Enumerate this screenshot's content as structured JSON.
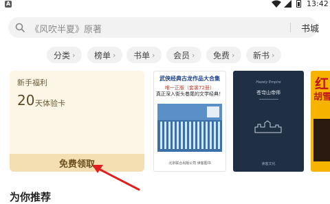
{
  "status_bar": {
    "app_badge": "A",
    "time": "13:42"
  },
  "search": {
    "placeholder": "《风吹半夏》原著",
    "library_label": "书城"
  },
  "categories": [
    {
      "label": "分类"
    },
    {
      "label": "榜单"
    },
    {
      "label": "书单"
    },
    {
      "label": "会员"
    },
    {
      "label": "免费"
    },
    {
      "label": "新书"
    }
  ],
  "welfare": {
    "title": "新手福利",
    "days": "20",
    "unit": "天体验卡",
    "claim_label": "免费领取"
  },
  "books": [
    {
      "title": "武侠经典古龙作品大合集",
      "subtitle": "唯一正版（套装72册）",
      "tagline": "真正深入街头巷尾的文学经典！",
      "badge": "北京联合出版公司  读客图书"
    },
    {
      "top": "Hazely Empire",
      "title": "苍穹山帝师",
      "bottom": "读客文化"
    },
    {
      "title": "红",
      "subtitle": "胡雪"
    }
  ],
  "section": {
    "title": "为你推荐"
  }
}
